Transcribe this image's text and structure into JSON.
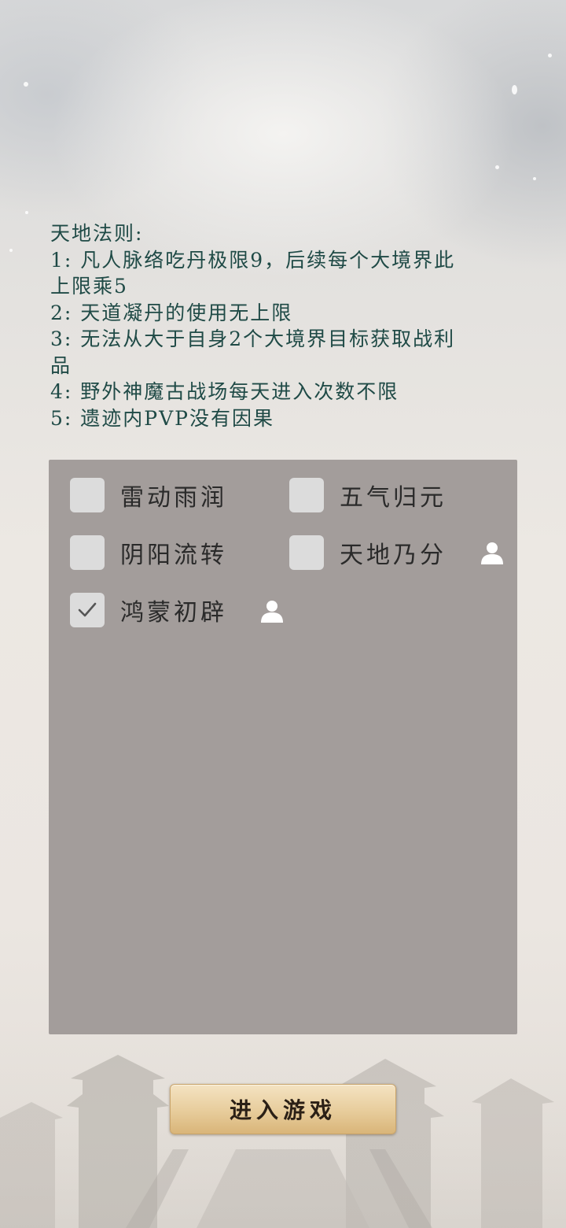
{
  "rules": {
    "title": "天地法则:",
    "items": [
      "1: 凡人脉络吃丹极限9，后续每个大境界此",
      "上限乘5",
      "2: 天道凝丹的使用无上限",
      "3: 无法从大于自身2个大境界目标获取战利",
      "品",
      "4: 野外神魔古战场每天进入次数不限",
      "5: 遗迹内PVP没有因果"
    ]
  },
  "options": [
    {
      "label": "雷动雨润",
      "checked": false,
      "has_player_icon": false
    },
    {
      "label": "五气归元",
      "checked": false,
      "has_player_icon": false
    },
    {
      "label": "阴阳流转",
      "checked": false,
      "has_player_icon": false
    },
    {
      "label": "天地乃分",
      "checked": false,
      "has_player_icon": true
    },
    {
      "label": "鸿蒙初辟",
      "checked": true,
      "has_player_icon": true
    }
  ],
  "enter_button": {
    "label": "进入游戏"
  },
  "colors": {
    "rules_text": "#1f4a46",
    "panel_bg": "#a39d9b",
    "checkbox_bg": "#dcdcdc",
    "button_gold": "#e7cc9b"
  }
}
